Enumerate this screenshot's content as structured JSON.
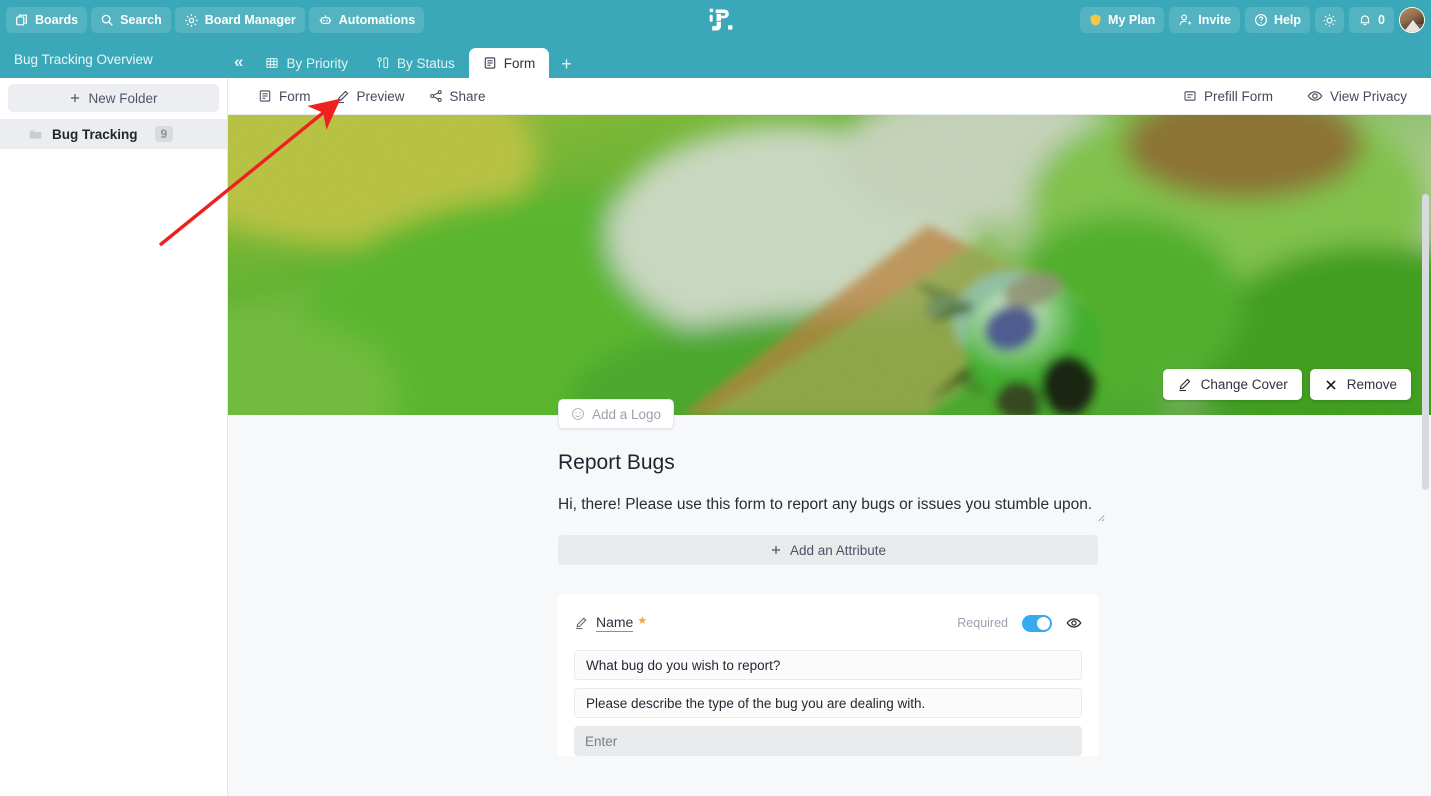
{
  "topbar": {
    "left_buttons": [
      {
        "label": "Boards",
        "icon": "boards-icon"
      },
      {
        "label": "Search",
        "icon": "search-icon"
      },
      {
        "label": "Board Manager",
        "icon": "gear-icon"
      },
      {
        "label": "Automations",
        "icon": "robot-icon"
      }
    ],
    "logo": "app-logo",
    "right_buttons": [
      {
        "label": "My Plan",
        "icon": "shield-icon"
      },
      {
        "label": "Invite",
        "icon": "person-add-icon"
      },
      {
        "label": "Help",
        "icon": "question-circle-icon"
      }
    ],
    "theme_toggle_icon": "sun-icon",
    "notifications": {
      "icon": "bell-icon",
      "count": "0"
    },
    "avatar": "user-avatar"
  },
  "tabbar": {
    "board_title": "Bug Tracking Overview",
    "collapse_icon": "«",
    "tabs": [
      {
        "label": "By Priority",
        "icon": "table-icon",
        "active": false
      },
      {
        "label": "By Status",
        "icon": "kanban-icon",
        "active": false
      },
      {
        "label": "Form",
        "icon": "form-icon",
        "active": true
      }
    ],
    "add_tab_label": "+"
  },
  "sidebar": {
    "new_folder_label": "New Folder",
    "new_folder_icon": "plus-icon",
    "folders": [
      {
        "name": "Bug Tracking",
        "count": "9",
        "icon": "folder-icon"
      }
    ]
  },
  "toolbar": {
    "left": [
      {
        "label": "Form",
        "icon": "form-icon"
      },
      {
        "label": "Preview",
        "icon": "pencil-icon"
      },
      {
        "label": "Share",
        "icon": "share-icon"
      }
    ],
    "right": [
      {
        "label": "Prefill Form",
        "icon": "prefill-icon"
      },
      {
        "label": "View Privacy",
        "icon": "eye-icon"
      }
    ]
  },
  "cover": {
    "change_label": "Change Cover",
    "change_icon": "pencil-icon",
    "remove_label": "Remove",
    "remove_icon": "close-icon",
    "image_description": "green-beetle-on-leaf"
  },
  "form": {
    "add_logo_label": "Add a Logo",
    "add_logo_icon": "smiley-icon",
    "title": "Report Bugs",
    "description": "Hi, there! Please use this form to report any bugs or issues you stumble upon.",
    "add_attribute_label": "Add an Attribute",
    "add_attribute_icon": "plus-icon",
    "fields": [
      {
        "label": "Name",
        "label_icon": "pencil-icon",
        "required_marker": "★",
        "required_text": "Required",
        "required_on": true,
        "visibility_icon": "eye-icon",
        "question": "What bug do you wish to report?",
        "help_text": "Please describe the type of the bug you are dealing with.",
        "input_placeholder": "Enter"
      }
    ]
  },
  "colors": {
    "brand_teal": "#3aa8b8",
    "toggle_blue": "#36a9f2",
    "required_star": "#f0a93b",
    "annotation_red": "#ee2020",
    "page_bg": "#f7f8fa"
  }
}
